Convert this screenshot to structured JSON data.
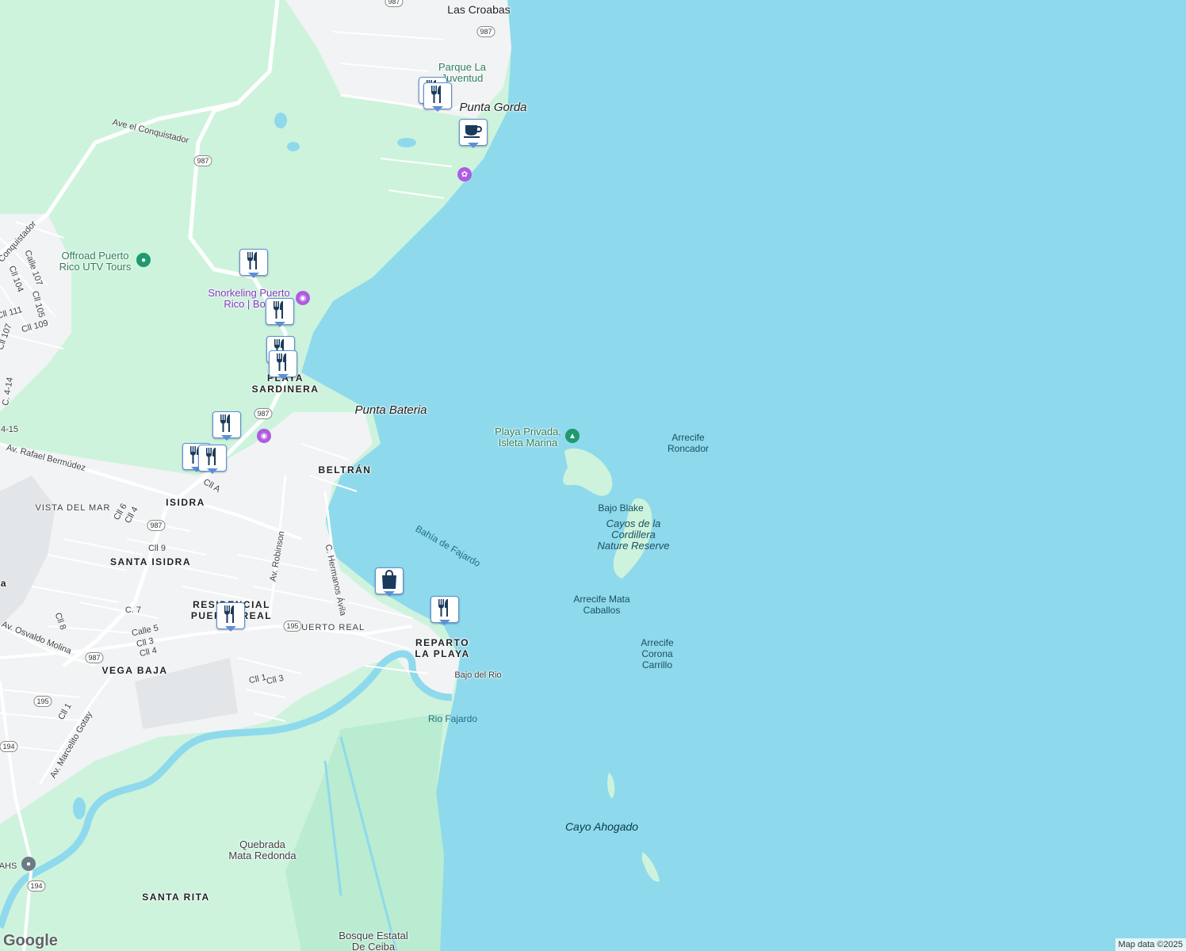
{
  "places": {
    "las_croabas": "Las Croabas",
    "parque_la_juventud": "Parque La\nJuventud",
    "punta_gorda": "Punta Gorda",
    "ave_el_conquistador": "Ave el Conquistador",
    "offroad": "Offroad Puerto\nRico UTV Tours",
    "snorkeling": "Snorkeling Puerto\nRico | Boat",
    "playa_sardinera": "PLAYA\nSARDINERA",
    "punta_bateria": "Punta Bateria",
    "playa_privada": "Playa Privada,\nIsleta Marina",
    "arrecife_roncador": "Arrecife\nRoncador",
    "beltran": "BELTRÁN",
    "av_rafael_bermudez": "Av. Rafael Bermúdez",
    "vista_del_mar": "VISTA DEL MAR",
    "isidra": "ISIDRA",
    "santa_isidra": "SANTA ISIDRA",
    "bahia_de_fajardo": "Bahía de Fajardo",
    "bajo_blake": "Bajo Blake",
    "cayos_cordillera": "Cayos de la\nCordillera\nNature Reserve",
    "arrecife_mata_caballos": "Arrecife Mata\nCaballos",
    "residencial_puerto_real": "RESIDENCIAL\nPUERTO REAL",
    "puerto_real": "PUERTO REAL",
    "reparto_la_playa": "REPARTO\nLA PLAYA",
    "arrecife_corona_carrillo": "Arrecife\nCorona\nCarrillo",
    "bajo_del_rio": "Bajo del Rio",
    "vega_baja": "VEGA BAJA",
    "rio_fajardo": "Rio Fajardo",
    "cayo_ahogado": "Cayo Ahogado",
    "quebrada_mata_redonda": "Quebrada\nMata Redonda",
    "santa_rita": "SANTA RITA",
    "bosque_estatal": "Bosque Estatal\nDe Ceiba",
    "ahs": "AHS",
    "conquistador_partial": "Conquistador",
    "av_robinson": "Av. Robinson",
    "c_hermanos_avila": "C. Hermanos Ávila",
    "av_osvaldo_molina": "Av. Osvaldo Molina",
    "av_marcelito_gotay": "Av. Marcelito Gotay"
  },
  "streets": {
    "calle_107": "Calle 107",
    "cll_104": "Cll 104",
    "cll_105": "Cll 105",
    "cll_111": "Cll 111",
    "cll_109": "Cll 109",
    "cll_107": "Cll 107",
    "c_414": "C. 4-14",
    "c_415": "4-15",
    "cll_a": "Cll A",
    "cll_6": "Cll 6",
    "cll_4a": "Cll 4",
    "cll_9": "Cll 9",
    "c_7": "C. 7",
    "cll_8": "Cll 8",
    "calle_5": "Calle 5",
    "cll_3a": "Cll 3",
    "cll_4b": "Cll 4",
    "cll_1a": "Cll 1",
    "cll_3b": "Cll 3",
    "cll_1b": "Cll 1",
    "a_partial": "a"
  },
  "shields": {
    "r987_top": "987",
    "r987_a": "987",
    "r987_b": "987",
    "r987_c": "987",
    "r987_d": "987",
    "r987_e": "987",
    "r195_a": "195",
    "r195_b": "195",
    "r194_a": "194",
    "r194_b": "194"
  },
  "markers": [
    {
      "name": "restaurant-marker",
      "icon": "fork-knife-icon"
    },
    {
      "name": "restaurant-marker",
      "icon": "fork-knife-icon"
    },
    {
      "name": "cafe-marker",
      "icon": "coffee-cup-icon"
    },
    {
      "name": "restaurant-marker",
      "icon": "fork-knife-icon"
    },
    {
      "name": "restaurant-marker",
      "icon": "fork-knife-icon"
    },
    {
      "name": "restaurant-marker",
      "icon": "fork-knife-icon"
    },
    {
      "name": "restaurant-marker",
      "icon": "fork-knife-icon"
    },
    {
      "name": "restaurant-marker",
      "icon": "fork-knife-icon"
    },
    {
      "name": "restaurant-marker",
      "icon": "fork-knife-icon"
    },
    {
      "name": "restaurant-marker",
      "icon": "fork-knife-icon"
    },
    {
      "name": "shopping-marker",
      "icon": "shopping-bag-icon"
    },
    {
      "name": "restaurant-marker",
      "icon": "fork-knife-icon"
    },
    {
      "name": "restaurant-marker",
      "icon": "fork-knife-icon"
    }
  ],
  "colors": {
    "water": "#8fd9ec",
    "park": "#cdf3dd",
    "urban": "#f1f3f4",
    "road": "#ffffff",
    "marker_border": "#5b8fd6",
    "marker_icon": "#1a3a5c"
  },
  "attribution": "Map data ©2025",
  "logo": "Google"
}
